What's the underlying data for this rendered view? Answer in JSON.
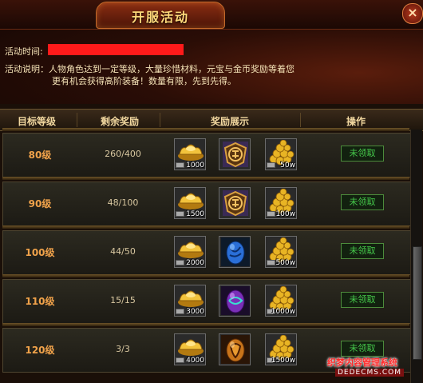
{
  "window": {
    "title": "开服活动",
    "close_glyph": "×"
  },
  "info": {
    "time_label": "活动时间:",
    "time_value": "",
    "desc_line1": "活动说明：人物角色达到一定等级，大量珍惜材料，元宝与金币奖励等着您",
    "desc_line2": "更有机会获得高阶装备！数量有限，先到先得。"
  },
  "table": {
    "headers": [
      "目标等级",
      "剩余奖励",
      "奖励展示",
      "操作"
    ],
    "rows": [
      {
        "level": "80级",
        "remaining": "260/400",
        "rewards": [
          {
            "icon": "gold-ingot-icon",
            "qty": "1000"
          },
          {
            "icon": "token-badge-icon",
            "qty": ""
          },
          {
            "icon": "gold-coins-icon",
            "qty": "50w"
          }
        ],
        "action": "未领取"
      },
      {
        "level": "90级",
        "remaining": "48/100",
        "rewards": [
          {
            "icon": "gold-ingot-icon",
            "qty": "1500"
          },
          {
            "icon": "token-badge-icon",
            "qty": ""
          },
          {
            "icon": "gold-coins-icon",
            "qty": "100w"
          }
        ],
        "action": "未领取"
      },
      {
        "level": "100级",
        "remaining": "44/50",
        "rewards": [
          {
            "icon": "gold-ingot-icon",
            "qty": "2000"
          },
          {
            "icon": "blue-egg-icon",
            "qty": ""
          },
          {
            "icon": "gold-coins-icon",
            "qty": "500w"
          }
        ],
        "action": "未领取"
      },
      {
        "level": "110级",
        "remaining": "15/15",
        "rewards": [
          {
            "icon": "gold-ingot-icon",
            "qty": "3000"
          },
          {
            "icon": "purple-egg-icon",
            "qty": ""
          },
          {
            "icon": "gold-coins-icon",
            "qty": "1000w"
          }
        ],
        "action": "未领取"
      },
      {
        "level": "120级",
        "remaining": "3/3",
        "rewards": [
          {
            "icon": "gold-ingot-icon",
            "qty": "4000"
          },
          {
            "icon": "orange-egg-icon",
            "qty": ""
          },
          {
            "icon": "gold-coins-icon",
            "qty": "1500w"
          }
        ],
        "action": "未领取"
      }
    ]
  },
  "watermark": {
    "line1": "织梦内容管理系统",
    "line2": "DEDECMS.COM"
  },
  "colors": {
    "accent_gold": "#f0a24a",
    "claim_green": "#45c84a",
    "redacted": "#ff1a1a"
  }
}
